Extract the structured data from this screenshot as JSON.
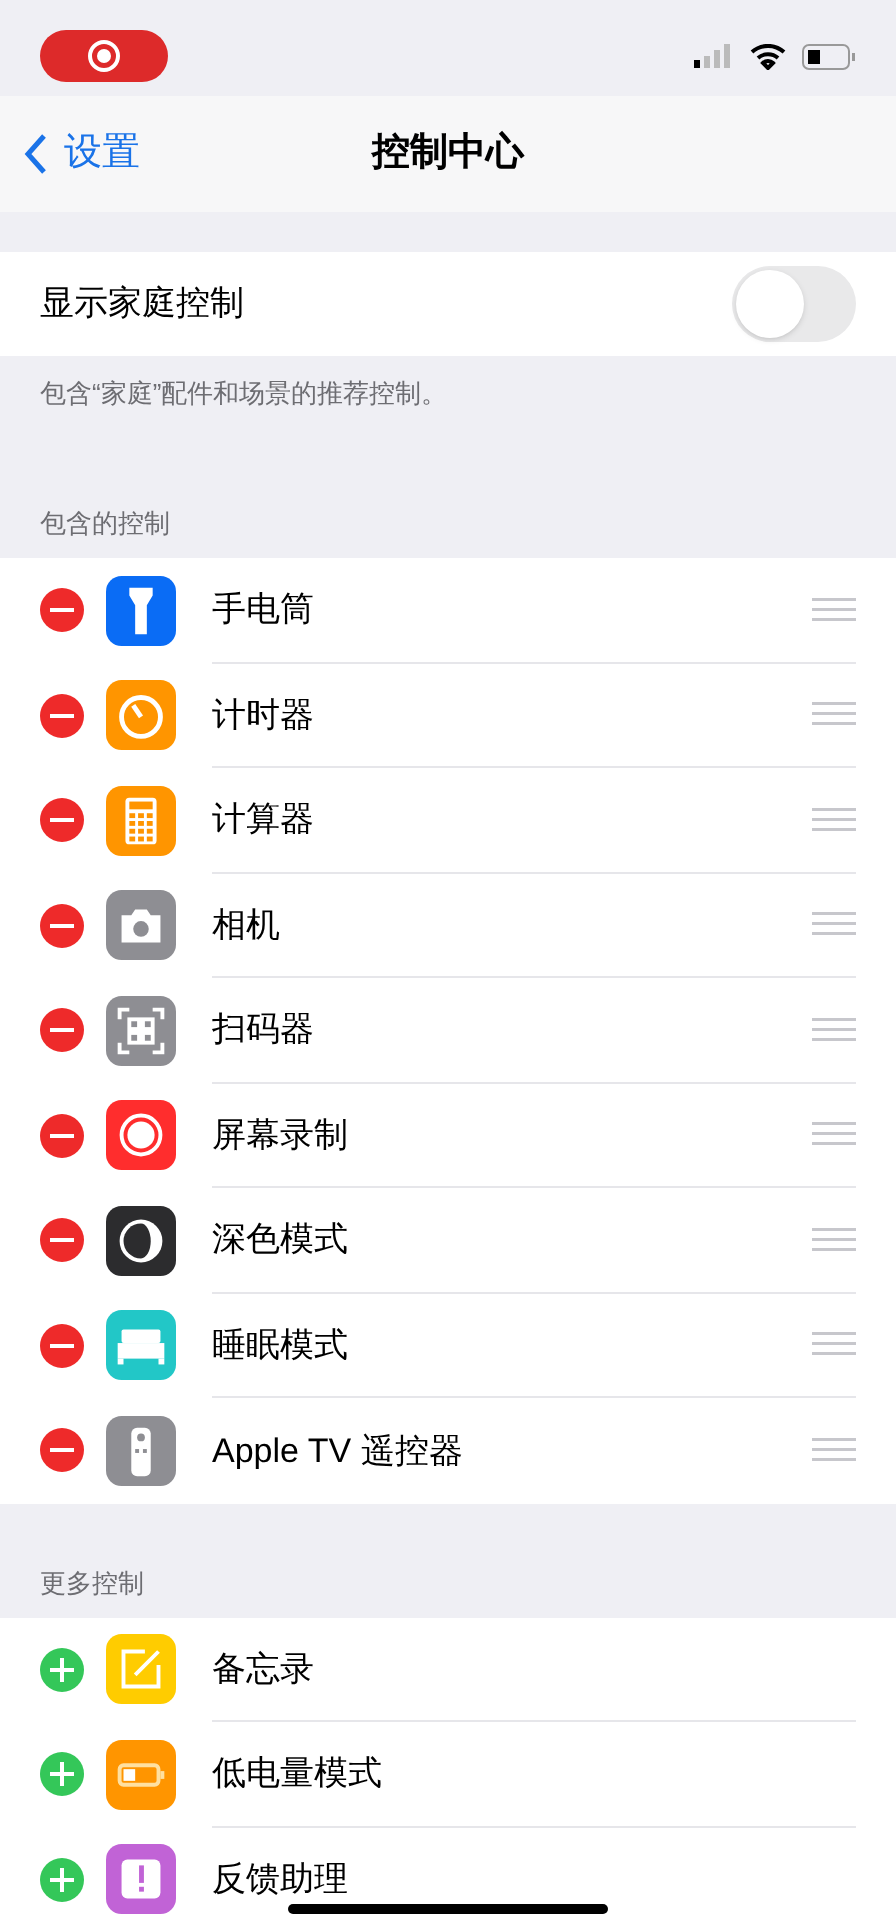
{
  "nav": {
    "back": "设置",
    "title": "控制中心"
  },
  "home_controls": {
    "label": "显示家庭控制",
    "on": false,
    "footer": "包含“家庭”配件和场景的推荐控制。"
  },
  "sections": [
    {
      "header": "包含的控制",
      "kind": "included",
      "items": [
        {
          "label": "手电筒",
          "kind": "flashlight",
          "color": "#0a6cf5"
        },
        {
          "label": "计时器",
          "kind": "timer",
          "color": "#ff9500"
        },
        {
          "label": "计算器",
          "kind": "calculator",
          "color": "#ff9500"
        },
        {
          "label": "相机",
          "kind": "camera",
          "color": "#8e8e93"
        },
        {
          "label": "扫码器",
          "kind": "qr",
          "color": "#8e8e93"
        },
        {
          "label": "屏幕录制",
          "kind": "record",
          "color": "#ff2d2d"
        },
        {
          "label": "深色模式",
          "kind": "dark",
          "color": "#2c2c2e"
        },
        {
          "label": "睡眠模式",
          "kind": "bed",
          "color": "#22c7c7"
        },
        {
          "label": "Apple TV 遥控器",
          "kind": "remote",
          "color": "#8e8e93"
        }
      ]
    },
    {
      "header": "更多控制",
      "kind": "more",
      "items": [
        {
          "label": "备忘录",
          "kind": "notes",
          "color": "#ffcc00"
        },
        {
          "label": "低电量模式",
          "kind": "battery",
          "color": "#ff9500"
        },
        {
          "label": "反馈助理",
          "kind": "feedback",
          "color": "#c163d6"
        }
      ]
    }
  ]
}
